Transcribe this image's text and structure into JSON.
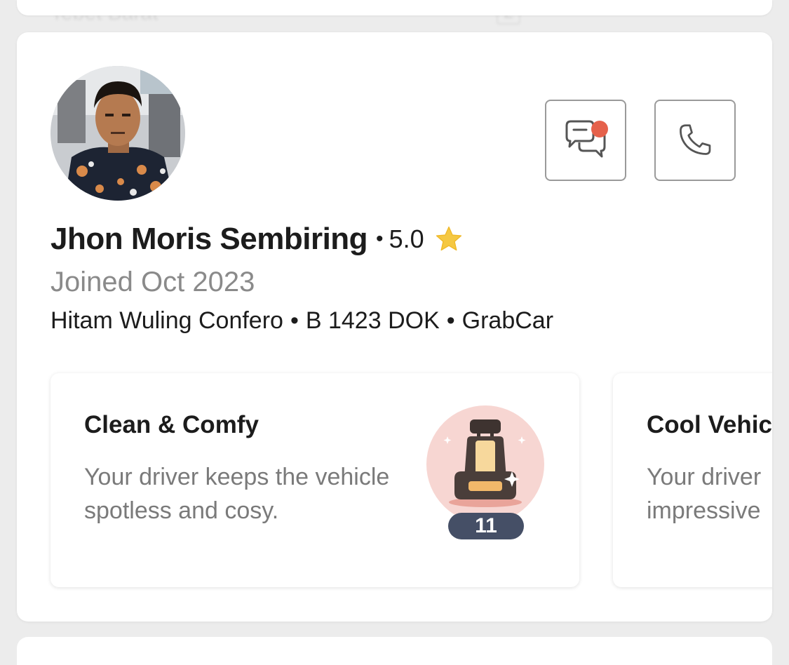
{
  "background": {
    "blurred_text": "Tebet Barat",
    "blurred_digit": "2"
  },
  "driver": {
    "name": "Jhon Moris Sembiring",
    "rating": "5.0",
    "joined": "Joined Oct 2023",
    "vehicle_color_model": "Hitam Wuling Confero",
    "plate": "B 1423 DOK",
    "service": "GrabCar",
    "separator": "•"
  },
  "actions": {
    "chat_icon": "chat-bubbles-icon",
    "call_icon": "phone-icon",
    "chat_has_notification": true
  },
  "badges": [
    {
      "title": "Clean & Comfy",
      "description": "Your driver keeps the vehicle spotless and cosy.",
      "count": "11",
      "icon": "car-seat-icon"
    },
    {
      "title": "Cool Vehic",
      "description_line1": "Your driver",
      "description_line2": "impressive"
    }
  ],
  "colors": {
    "star": "#f5c842",
    "notification_dot": "#e5614b",
    "badge_count_bg": "#454f66",
    "badge_icon_bg": "#f7d6d2"
  }
}
